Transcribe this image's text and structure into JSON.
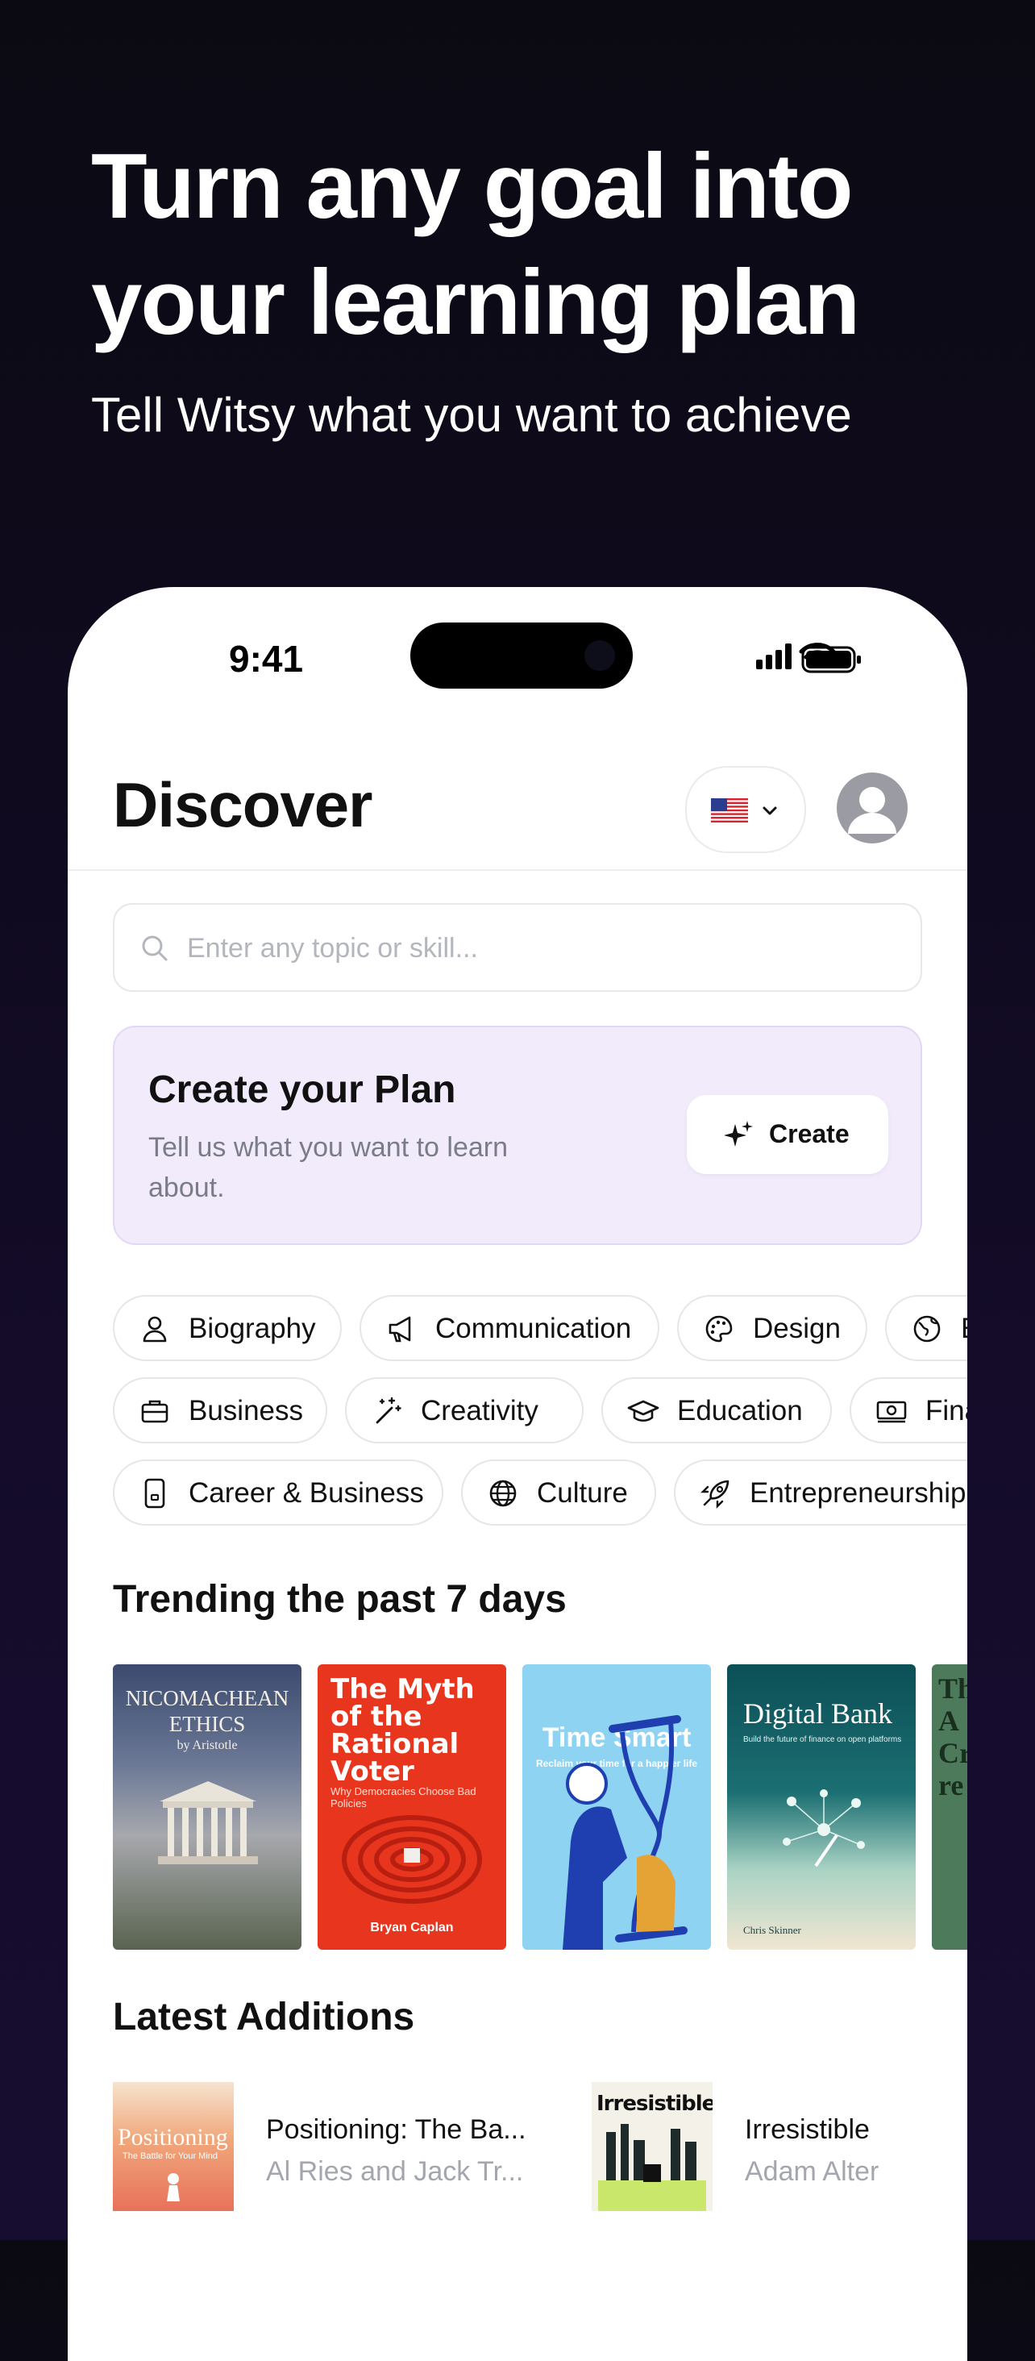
{
  "hero": {
    "title_line1": "Turn any goal into",
    "title_line2": "your learning plan",
    "subtitle": "Tell Witsy what you want to achieve"
  },
  "status_bar": {
    "time": "9:41"
  },
  "header": {
    "title": "Discover",
    "language_flag": "us-flag-icon"
  },
  "search": {
    "placeholder": "Enter any topic or skill..."
  },
  "plan_card": {
    "title": "Create your Plan",
    "description": "Tell us what you want to learn about.",
    "button_label": "Create"
  },
  "categories": {
    "row1": [
      "Biography",
      "Communication",
      "Design",
      "E"
    ],
    "row2": [
      "Business",
      "Creativity",
      "Education",
      "Finan"
    ],
    "row3": [
      "Career & Business",
      "Culture",
      "Entrepreneurship"
    ]
  },
  "trending": {
    "title": "Trending the past 7 days",
    "books": [
      {
        "cover_title": "NICOMACHEAN ETHICS",
        "cover_author": "by Aristotle"
      },
      {
        "cover_title": "The Myth of the Rational Voter",
        "cover_subtitle": "Why Democracies Choose Bad Policies",
        "cover_author": "Bryan Caplan"
      },
      {
        "cover_title": "Time Smart",
        "cover_subtitle": "Reclaim your time for a happier life"
      },
      {
        "cover_title": "Digital Bank",
        "cover_subtitle": "Build the future of finance on open platforms",
        "cover_author": "Chris Skinner"
      },
      {
        "cover_title": "Th A Cr re"
      }
    ]
  },
  "latest": {
    "title": "Latest Additions",
    "items": [
      {
        "title": "Positioning: The Ba...",
        "author": "Al Ries and Jack Tr...",
        "cover_title": "Positioning",
        "cover_subtitle": "The Battle for Your Mind"
      },
      {
        "title": "Irresistible",
        "author": "Adam Alter",
        "cover_title": "Irresistible"
      }
    ]
  },
  "colors": {
    "background": "#100b1f",
    "plan_card": "#f1ebfc",
    "book2_cover": "#e8351e",
    "book3_cover": "#8fd3f2",
    "book4_cover": "#0f5a5e"
  }
}
